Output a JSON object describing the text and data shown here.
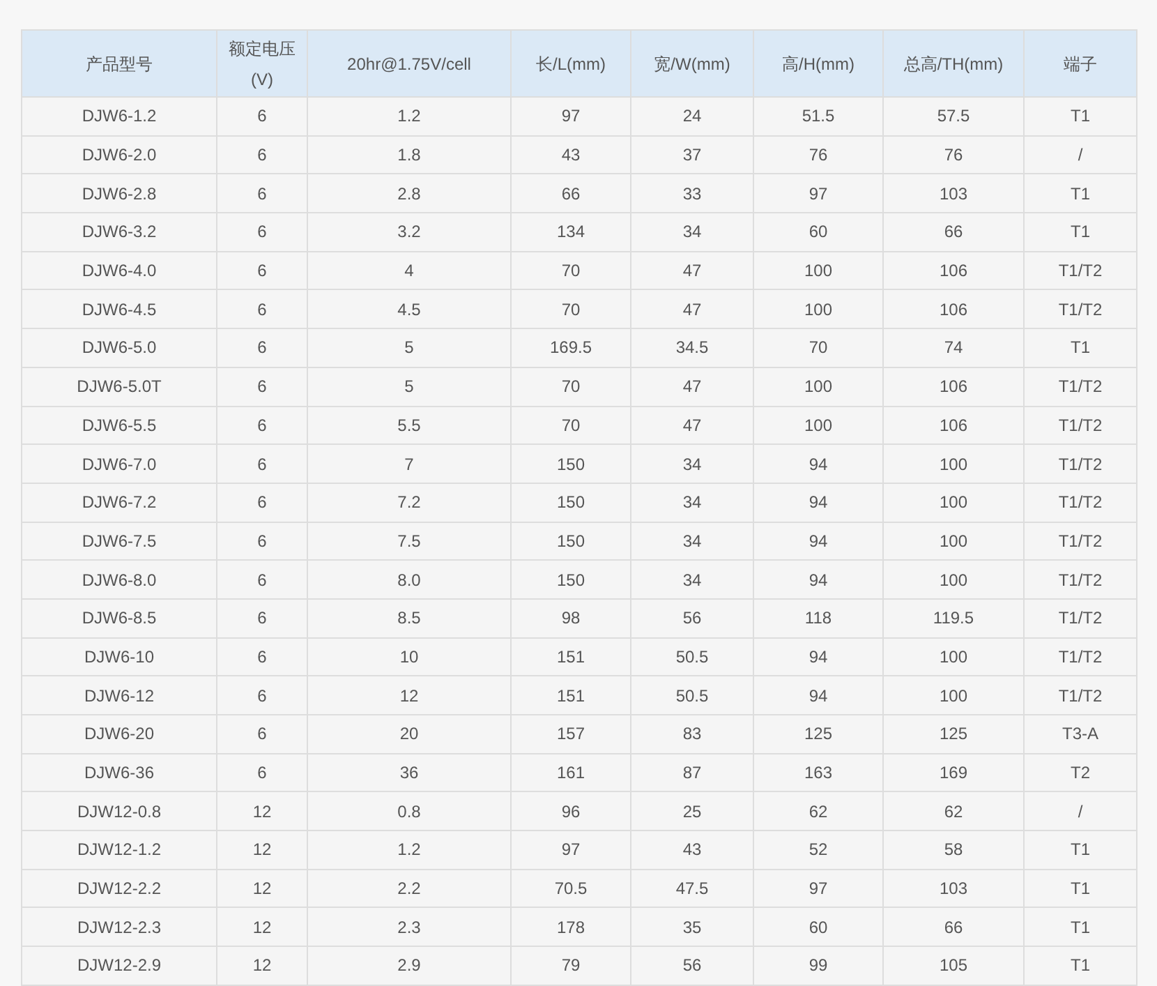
{
  "table": {
    "columns": [
      "产品型号",
      "额定电压 (V)",
      "20hr@1.75V/cell",
      "长/L(mm)",
      "宽/W(mm)",
      "高/H(mm)",
      "总高/TH(mm)",
      "端子"
    ],
    "rows": [
      [
        "DJW6-1.2",
        "6",
        "1.2",
        "97",
        "24",
        "51.5",
        "57.5",
        "T1"
      ],
      [
        "DJW6-2.0",
        "6",
        "1.8",
        "43",
        "37",
        "76",
        "76",
        "/"
      ],
      [
        "DJW6-2.8",
        "6",
        "2.8",
        "66",
        "33",
        "97",
        "103",
        "T1"
      ],
      [
        "DJW6-3.2",
        "6",
        "3.2",
        "134",
        "34",
        "60",
        "66",
        "T1"
      ],
      [
        "DJW6-4.0",
        "6",
        "4",
        "70",
        "47",
        "100",
        "106",
        "T1/T2"
      ],
      [
        "DJW6-4.5",
        "6",
        "4.5",
        "70",
        "47",
        "100",
        "106",
        "T1/T2"
      ],
      [
        "DJW6-5.0",
        "6",
        "5",
        "169.5",
        "34.5",
        "70",
        "74",
        "T1"
      ],
      [
        "DJW6-5.0T",
        "6",
        "5",
        "70",
        "47",
        "100",
        "106",
        "T1/T2"
      ],
      [
        "DJW6-5.5",
        "6",
        "5.5",
        "70",
        "47",
        "100",
        "106",
        "T1/T2"
      ],
      [
        "DJW6-7.0",
        "6",
        "7",
        "150",
        "34",
        "94",
        "100",
        "T1/T2"
      ],
      [
        "DJW6-7.2",
        "6",
        "7.2",
        "150",
        "34",
        "94",
        "100",
        "T1/T2"
      ],
      [
        "DJW6-7.5",
        "6",
        "7.5",
        "150",
        "34",
        "94",
        "100",
        "T1/T2"
      ],
      [
        "DJW6-8.0",
        "6",
        "8.0",
        "150",
        "34",
        "94",
        "100",
        "T1/T2"
      ],
      [
        "DJW6-8.5",
        "6",
        "8.5",
        "98",
        "56",
        "118",
        "119.5",
        "T1/T2"
      ],
      [
        "DJW6-10",
        "6",
        "10",
        "151",
        "50.5",
        "94",
        "100",
        "T1/T2"
      ],
      [
        "DJW6-12",
        "6",
        "12",
        "151",
        "50.5",
        "94",
        "100",
        "T1/T2"
      ],
      [
        "DJW6-20",
        "6",
        "20",
        "157",
        "83",
        "125",
        "125",
        "T3-A"
      ],
      [
        "DJW6-36",
        "6",
        "36",
        "161",
        "87",
        "163",
        "169",
        "T2"
      ],
      [
        "DJW12-0.8",
        "12",
        "0.8",
        "96",
        "25",
        "62",
        "62",
        "/"
      ],
      [
        "DJW12-1.2",
        "12",
        "1.2",
        "97",
        "43",
        "52",
        "58",
        "T1"
      ],
      [
        "DJW12-2.2",
        "12",
        "2.2",
        "70.5",
        "47.5",
        "97",
        "103",
        "T1"
      ],
      [
        "DJW12-2.3",
        "12",
        "2.3",
        "178",
        "35",
        "60",
        "66",
        "T1"
      ],
      [
        "DJW12-2.9",
        "12",
        "2.9",
        "79",
        "56",
        "99",
        "105",
        "T1"
      ]
    ]
  }
}
